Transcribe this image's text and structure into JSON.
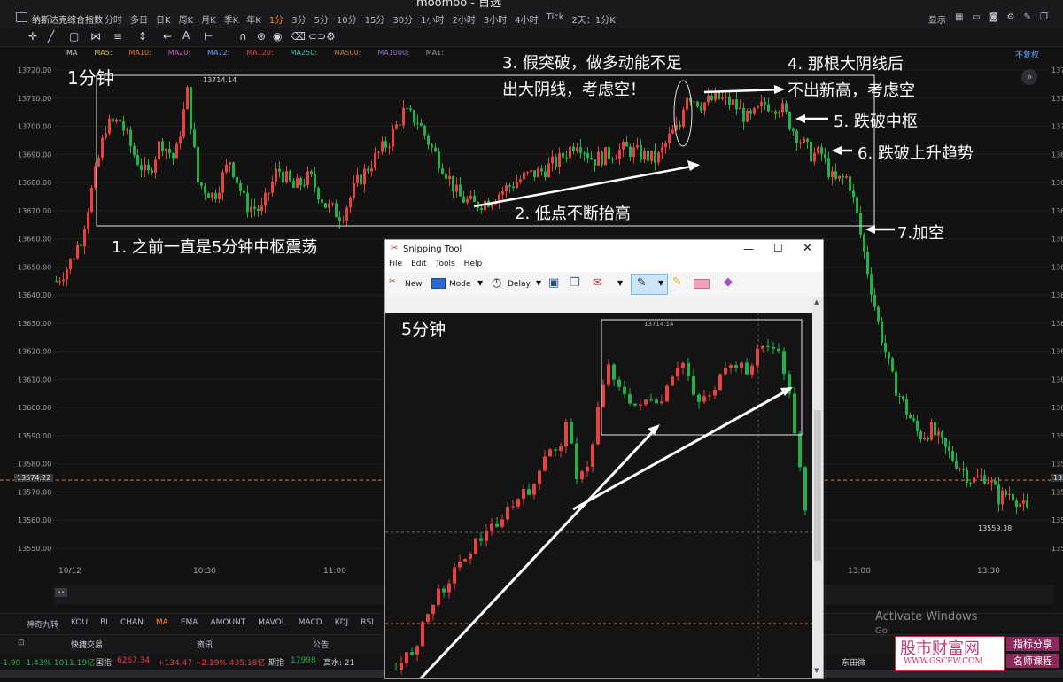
{
  "window": {
    "app_title": "moomoo - 首选"
  },
  "header": {
    "symbol_name": "纳斯达克综合指数",
    "periods": [
      "分时",
      "多日",
      "日K",
      "周K",
      "月K",
      "季K",
      "年K",
      "1分",
      "3分",
      "5分",
      "10分",
      "15分",
      "30分",
      "1小时",
      "2小时",
      "3小时",
      "4小时",
      "Tick",
      "2天：1分K"
    ],
    "active_period": "1分",
    "right_items": [
      "显示"
    ]
  },
  "ma_row": {
    "items": [
      "MA",
      "MA5:",
      "MA10:",
      "MA20:",
      "MA72:",
      "MA120:",
      "MA250:",
      "MA500:",
      "MA1000:",
      "MA1:"
    ],
    "adjust": "不复权"
  },
  "chart": {
    "price_ticks": [
      "13720.00",
      "13710.00",
      "13700.00",
      "13690.00",
      "13680.00",
      "13670.00",
      "13660.00",
      "13650.00",
      "13640.00",
      "13630.00",
      "13620.00",
      "13610.00",
      "13600.00",
      "13590.00",
      "13580.00",
      "13570.00",
      "13560.00",
      "13550.00"
    ],
    "current_price": "13574.22",
    "high_label": "13714.14",
    "low_label": "13559.38",
    "time_labels": [
      "10/12",
      "10:30",
      "11:00",
      "13:00",
      "13:30"
    ],
    "ylim": [
      13545,
      13725
    ],
    "colors": {
      "up": "#e8413e",
      "down": "#22b04a",
      "current_line": "#e07b2a"
    }
  },
  "annotations": {
    "a_title": "1分钟",
    "a1": "1. 之前一直是5分钟中枢震荡",
    "a2": "2. 低点不断抬高",
    "a3_line1": "3. 假突破，做多动能不足",
    "a3_line2": "出大阴线，考虑空！",
    "a4_line1": "4. 那根大阴线后",
    "a4_line2": "不出新高，考虑空",
    "a5": "5. 跌破中枢",
    "a6": "6. 跌破上升趋势",
    "a7": "7.加空"
  },
  "indicators": {
    "items": [
      "神奇九转",
      "KOU",
      "BI",
      "CHAN",
      "MA",
      "EMA",
      "AMOUNT",
      "MAVOL",
      "MACD",
      "KDJ",
      "RSI"
    ],
    "active": "MA"
  },
  "tabs": {
    "items": [
      "快捷交易",
      "资讯",
      "公告"
    ]
  },
  "ticker": {
    "t1": "-1.90  -1.43%  1011.19亿",
    "t2_label": "国指",
    "t2_value": "6267.34",
    "t2_change": "+134.47  +2.19%  435.18亿",
    "t3_label": "期指",
    "t3_value": "17998",
    "t4": "高水: 21",
    "t5": "东田微"
  },
  "snipping_tool": {
    "title": "Snipping Tool",
    "menu": [
      "File",
      "Edit",
      "Tools",
      "Help"
    ],
    "toolbar": {
      "new": "New",
      "mode": "Mode",
      "delay": "Delay"
    },
    "canvas_title": "5分钟",
    "high_label": "13714.14"
  },
  "overlay": {
    "activate_windows": "Activate Windows",
    "activate_sub": "Go"
  },
  "watermark": {
    "main": "股市财富网",
    "url": "WWW.GSCFW.COM",
    "tag1": "指标分享",
    "tag2": "名师课程"
  }
}
